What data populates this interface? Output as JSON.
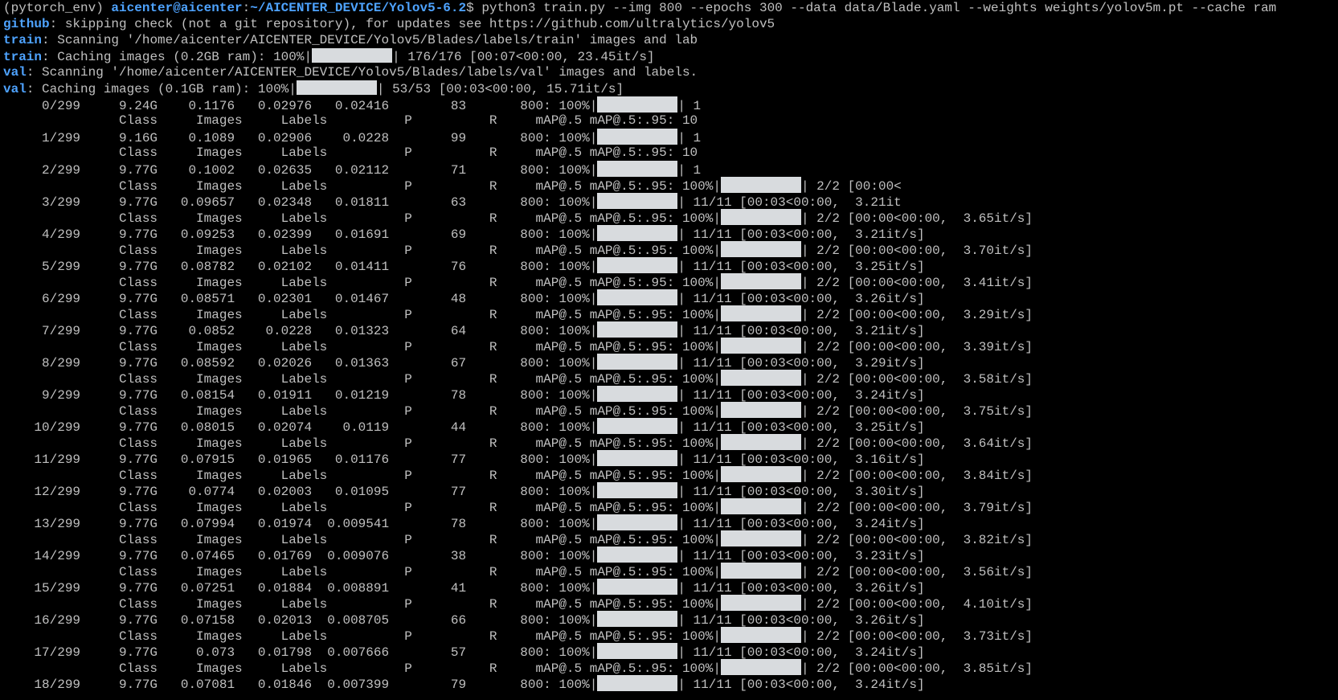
{
  "prompt": {
    "env": "(pytorch_env) ",
    "user": "aicenter@aicenter",
    "sep": ":",
    "path": "~/AICENTER_DEVICE/Yolov5-6.2",
    "dollar": "$ ",
    "command": "python3 train.py --img 800 --epochs 300 --data data/Blade.yaml --weights weights/yolov5m.pt --cache ram"
  },
  "github": {
    "tag": "github",
    "text": ": skipping check (not a git repository), for updates see https://github.com/ultralytics/yolov5"
  },
  "train_scan": {
    "tag": "train",
    "text": ": Scanning '/home/aicenter/AICENTER_DEVICE/Yolov5/Blades/labels/train' images and lab"
  },
  "train_cache": {
    "tag": "train",
    "pre": ": Caching images (0.2GB ram): 100%|",
    "post": "| 176/176 [00:07<00:00, 23.45it/s]"
  },
  "val_scan": {
    "tag": "val",
    "text": ": Scanning '/home/aicenter/AICENTER_DEVICE/Yolov5/Blades/labels/val' images and labels."
  },
  "val_cache": {
    "tag": "val",
    "pre": ": Caching images (0.1GB ram): 100%|",
    "post": "| 53/53 [00:03<00:00, 15.71it/s]"
  },
  "epochs": [
    {
      "train_pre": "     0/299     9.24G    0.1176   0.02976   0.02416        83       800: 100%|",
      "train_post": "| 1",
      "val_pre": "               Class     Images     Labels          P          R     mAP@.5 mAP@.5:.95: 10",
      "val_post": ""
    },
    {
      "train_pre": "     1/299     9.16G    0.1089   0.02906    0.0228        99       800: 100%|",
      "train_post": "| 1",
      "val_pre": "               Class     Images     Labels          P          R     mAP@.5 mAP@.5:.95: 10",
      "val_post": ""
    },
    {
      "train_pre": "     2/299     9.77G    0.1002   0.02635   0.02112        71       800: 100%|",
      "train_post": "| 1",
      "val_pre": "               Class     Images     Labels          P          R     mAP@.5 mAP@.5:.95: 100%|",
      "val_post": "| 2/2 [00:00<"
    },
    {
      "train_pre": "     3/299     9.77G   0.09657   0.02348   0.01811        63       800: 100%|",
      "train_post": "| 11/11 [00:03<00:00,  3.21it",
      "val_pre": "               Class     Images     Labels          P          R     mAP@.5 mAP@.5:.95: 100%|",
      "val_post": "| 2/2 [00:00<00:00,  3.65it/s]"
    },
    {
      "train_pre": "     4/299     9.77G   0.09253   0.02399   0.01691        69       800: 100%|",
      "train_post": "| 11/11 [00:03<00:00,  3.21it/s]",
      "val_pre": "               Class     Images     Labels          P          R     mAP@.5 mAP@.5:.95: 100%|",
      "val_post": "| 2/2 [00:00<00:00,  3.70it/s]"
    },
    {
      "train_pre": "     5/299     9.77G   0.08782   0.02102   0.01411        76       800: 100%|",
      "train_post": "| 11/11 [00:03<00:00,  3.25it/s]",
      "val_pre": "               Class     Images     Labels          P          R     mAP@.5 mAP@.5:.95: 100%|",
      "val_post": "| 2/2 [00:00<00:00,  3.41it/s]"
    },
    {
      "train_pre": "     6/299     9.77G   0.08571   0.02301   0.01467        48       800: 100%|",
      "train_post": "| 11/11 [00:03<00:00,  3.26it/s]",
      "val_pre": "               Class     Images     Labels          P          R     mAP@.5 mAP@.5:.95: 100%|",
      "val_post": "| 2/2 [00:00<00:00,  3.29it/s]"
    },
    {
      "train_pre": "     7/299     9.77G    0.0852    0.0228   0.01323        64       800: 100%|",
      "train_post": "| 11/11 [00:03<00:00,  3.21it/s]",
      "val_pre": "               Class     Images     Labels          P          R     mAP@.5 mAP@.5:.95: 100%|",
      "val_post": "| 2/2 [00:00<00:00,  3.39it/s]"
    },
    {
      "train_pre": "     8/299     9.77G   0.08592   0.02026   0.01363        67       800: 100%|",
      "train_post": "| 11/11 [00:03<00:00,  3.29it/s]",
      "val_pre": "               Class     Images     Labels          P          R     mAP@.5 mAP@.5:.95: 100%|",
      "val_post": "| 2/2 [00:00<00:00,  3.58it/s]"
    },
    {
      "train_pre": "     9/299     9.77G   0.08154   0.01911   0.01219        78       800: 100%|",
      "train_post": "| 11/11 [00:03<00:00,  3.24it/s]",
      "val_pre": "               Class     Images     Labels          P          R     mAP@.5 mAP@.5:.95: 100%|",
      "val_post": "| 2/2 [00:00<00:00,  3.75it/s]"
    },
    {
      "train_pre": "    10/299     9.77G   0.08015   0.02074    0.0119        44       800: 100%|",
      "train_post": "| 11/11 [00:03<00:00,  3.25it/s]",
      "val_pre": "               Class     Images     Labels          P          R     mAP@.5 mAP@.5:.95: 100%|",
      "val_post": "| 2/2 [00:00<00:00,  3.64it/s]"
    },
    {
      "train_pre": "    11/299     9.77G   0.07915   0.01965   0.01176        77       800: 100%|",
      "train_post": "| 11/11 [00:03<00:00,  3.16it/s]",
      "val_pre": "               Class     Images     Labels          P          R     mAP@.5 mAP@.5:.95: 100%|",
      "val_post": "| 2/2 [00:00<00:00,  3.84it/s]"
    },
    {
      "train_pre": "    12/299     9.77G    0.0774   0.02003   0.01095        77       800: 100%|",
      "train_post": "| 11/11 [00:03<00:00,  3.30it/s]",
      "val_pre": "               Class     Images     Labels          P          R     mAP@.5 mAP@.5:.95: 100%|",
      "val_post": "| 2/2 [00:00<00:00,  3.79it/s]"
    },
    {
      "train_pre": "    13/299     9.77G   0.07994   0.01974  0.009541        78       800: 100%|",
      "train_post": "| 11/11 [00:03<00:00,  3.24it/s]",
      "val_pre": "               Class     Images     Labels          P          R     mAP@.5 mAP@.5:.95: 100%|",
      "val_post": "| 2/2 [00:00<00:00,  3.82it/s]"
    },
    {
      "train_pre": "    14/299     9.77G   0.07465   0.01769  0.009076        38       800: 100%|",
      "train_post": "| 11/11 [00:03<00:00,  3.23it/s]",
      "val_pre": "               Class     Images     Labels          P          R     mAP@.5 mAP@.5:.95: 100%|",
      "val_post": "| 2/2 [00:00<00:00,  3.56it/s]"
    },
    {
      "train_pre": "    15/299     9.77G   0.07251   0.01884  0.008891        41       800: 100%|",
      "train_post": "| 11/11 [00:03<00:00,  3.26it/s]",
      "val_pre": "               Class     Images     Labels          P          R     mAP@.5 mAP@.5:.95: 100%|",
      "val_post": "| 2/2 [00:00<00:00,  4.10it/s]"
    },
    {
      "train_pre": "    16/299     9.77G   0.07158   0.02013  0.008705        66       800: 100%|",
      "train_post": "| 11/11 [00:03<00:00,  3.26it/s]",
      "val_pre": "               Class     Images     Labels          P          R     mAP@.5 mAP@.5:.95: 100%|",
      "val_post": "| 2/2 [00:00<00:00,  3.73it/s]"
    },
    {
      "train_pre": "    17/299     9.77G     0.073   0.01798  0.007666        57       800: 100%|",
      "train_post": "| 11/11 [00:03<00:00,  3.24it/s]",
      "val_pre": "               Class     Images     Labels          P          R     mAP@.5 mAP@.5:.95: 100%|",
      "val_post": "| 2/2 [00:00<00:00,  3.85it/s]"
    },
    {
      "train_pre": "    18/299     9.77G   0.07081   0.01846  0.007399        79       800: 100%|",
      "train_post": "| 11/11 [00:03<00:00,  3.24it/s]",
      "val_pre": null,
      "val_post": null
    }
  ],
  "colors": {
    "background": "#000000",
    "text": "#c0c0c0",
    "accent": "#4ea3ff",
    "progress_bar": "#d8dbde"
  }
}
